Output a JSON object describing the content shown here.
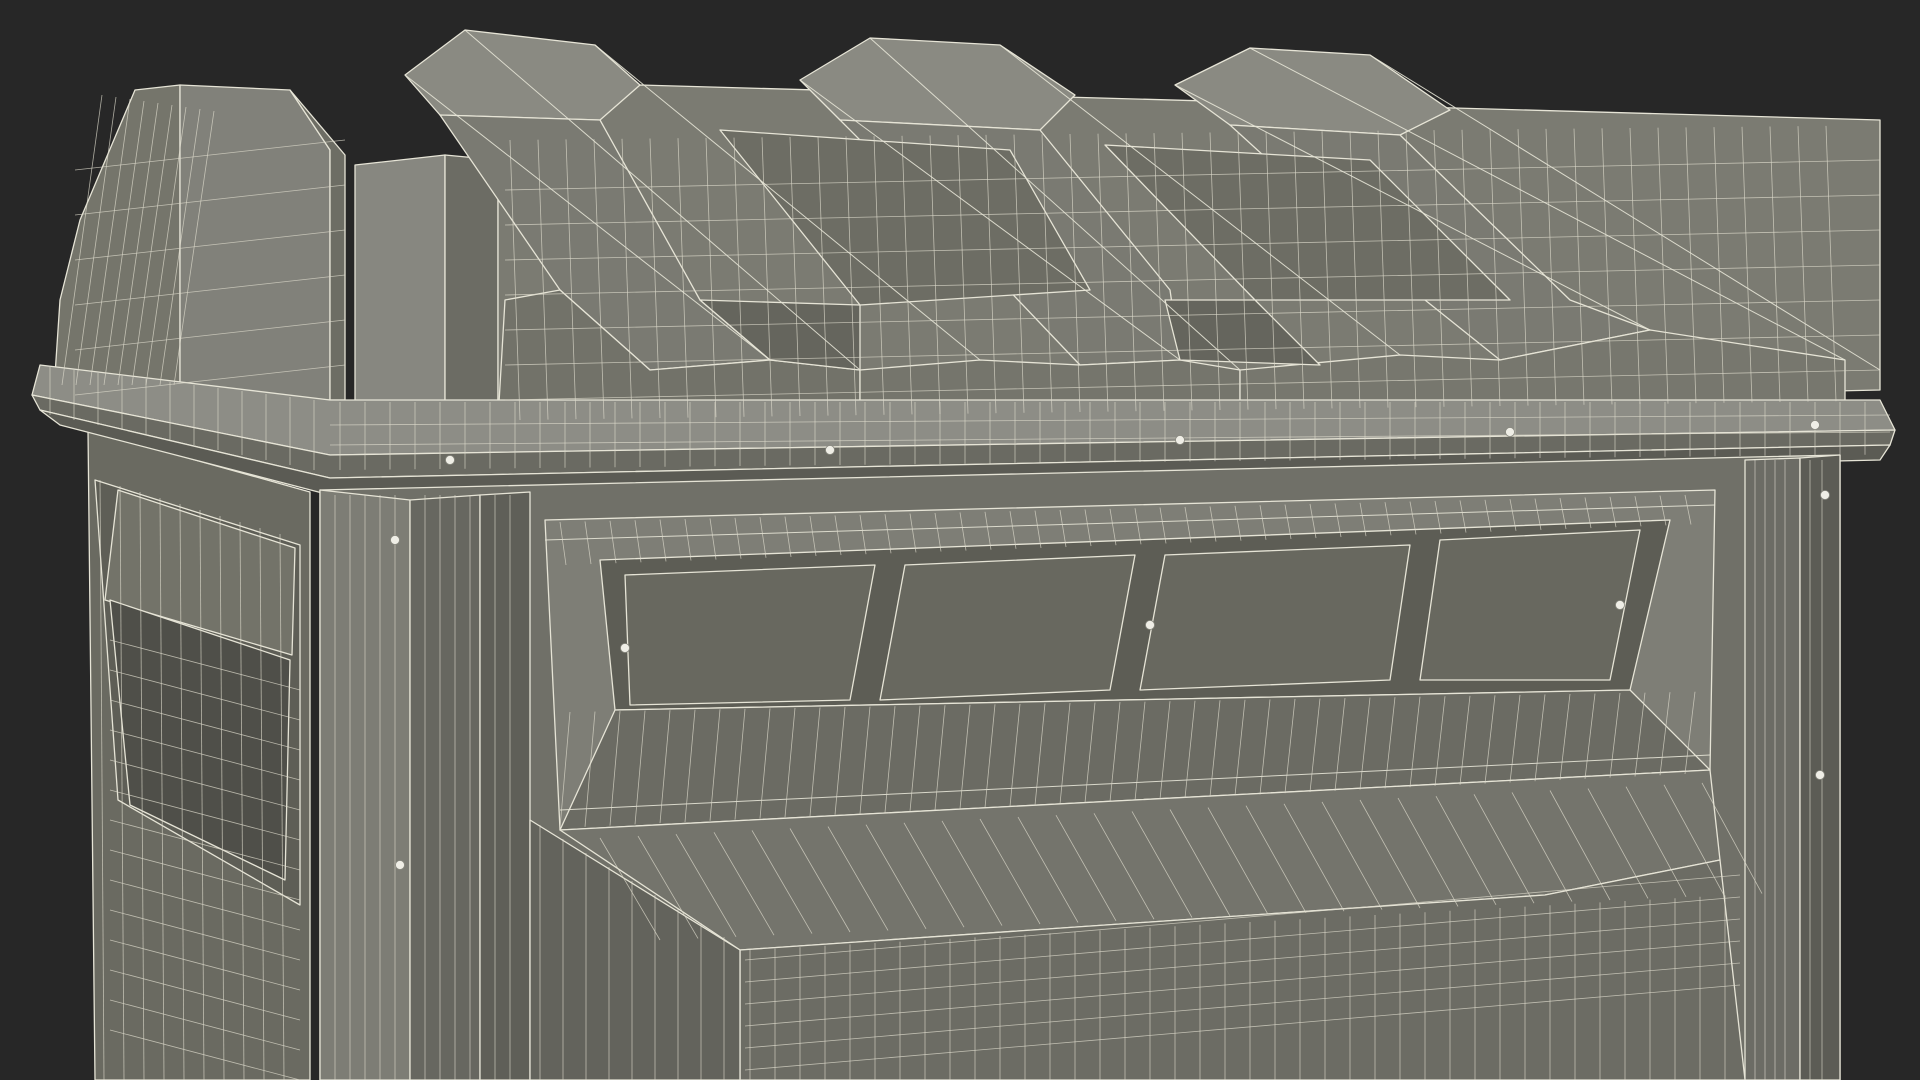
{
  "scene": {
    "subject": "wireframe-container-model",
    "colors": {
      "background": "#272727",
      "surface_light": "#7c7c72",
      "surface_mid": "#6f6f66",
      "surface_dark": "#5d5d55",
      "surface_shadow": "#4e4e47",
      "wire": "#e6e4d6",
      "bolt": "#efeee6"
    }
  }
}
